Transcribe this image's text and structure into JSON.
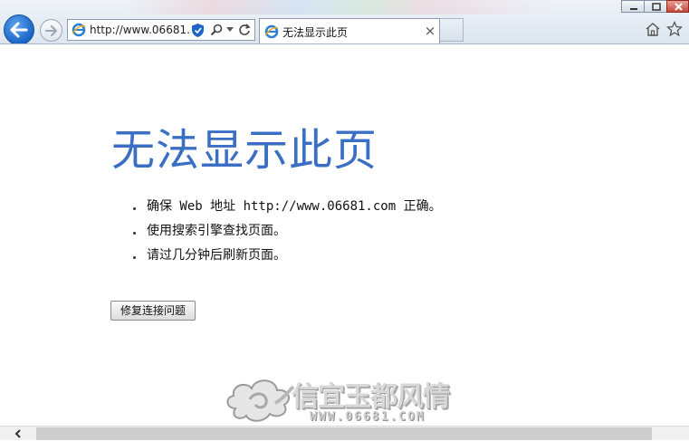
{
  "browser": {
    "address_url": "http://www.06681.c",
    "tab_title": "无法显示此页",
    "tab_close_label": "×"
  },
  "page": {
    "title": "无法显示此页",
    "suggestions": [
      "确保 Web 地址 http://www.06681.com 正确。",
      "使用搜索引擎查找页面。",
      "请过几分钟后刷新页面。"
    ],
    "fix_button_label": "修复连接问题"
  },
  "watermark": {
    "title": "信宜玉都风情",
    "url": "WWW.06681.COM"
  },
  "colors": {
    "title_blue": "#3a6fc4",
    "back_button_blue": "#1b64c4"
  },
  "icons": [
    "back-icon",
    "forward-icon",
    "ie-logo-icon",
    "shield-icon",
    "search-icon",
    "dropdown-icon",
    "refresh-icon",
    "close-icon",
    "home-icon",
    "favorites-star-icon",
    "minimize-icon",
    "maximize-icon",
    "window-close-icon",
    "scroll-left-icon"
  ]
}
